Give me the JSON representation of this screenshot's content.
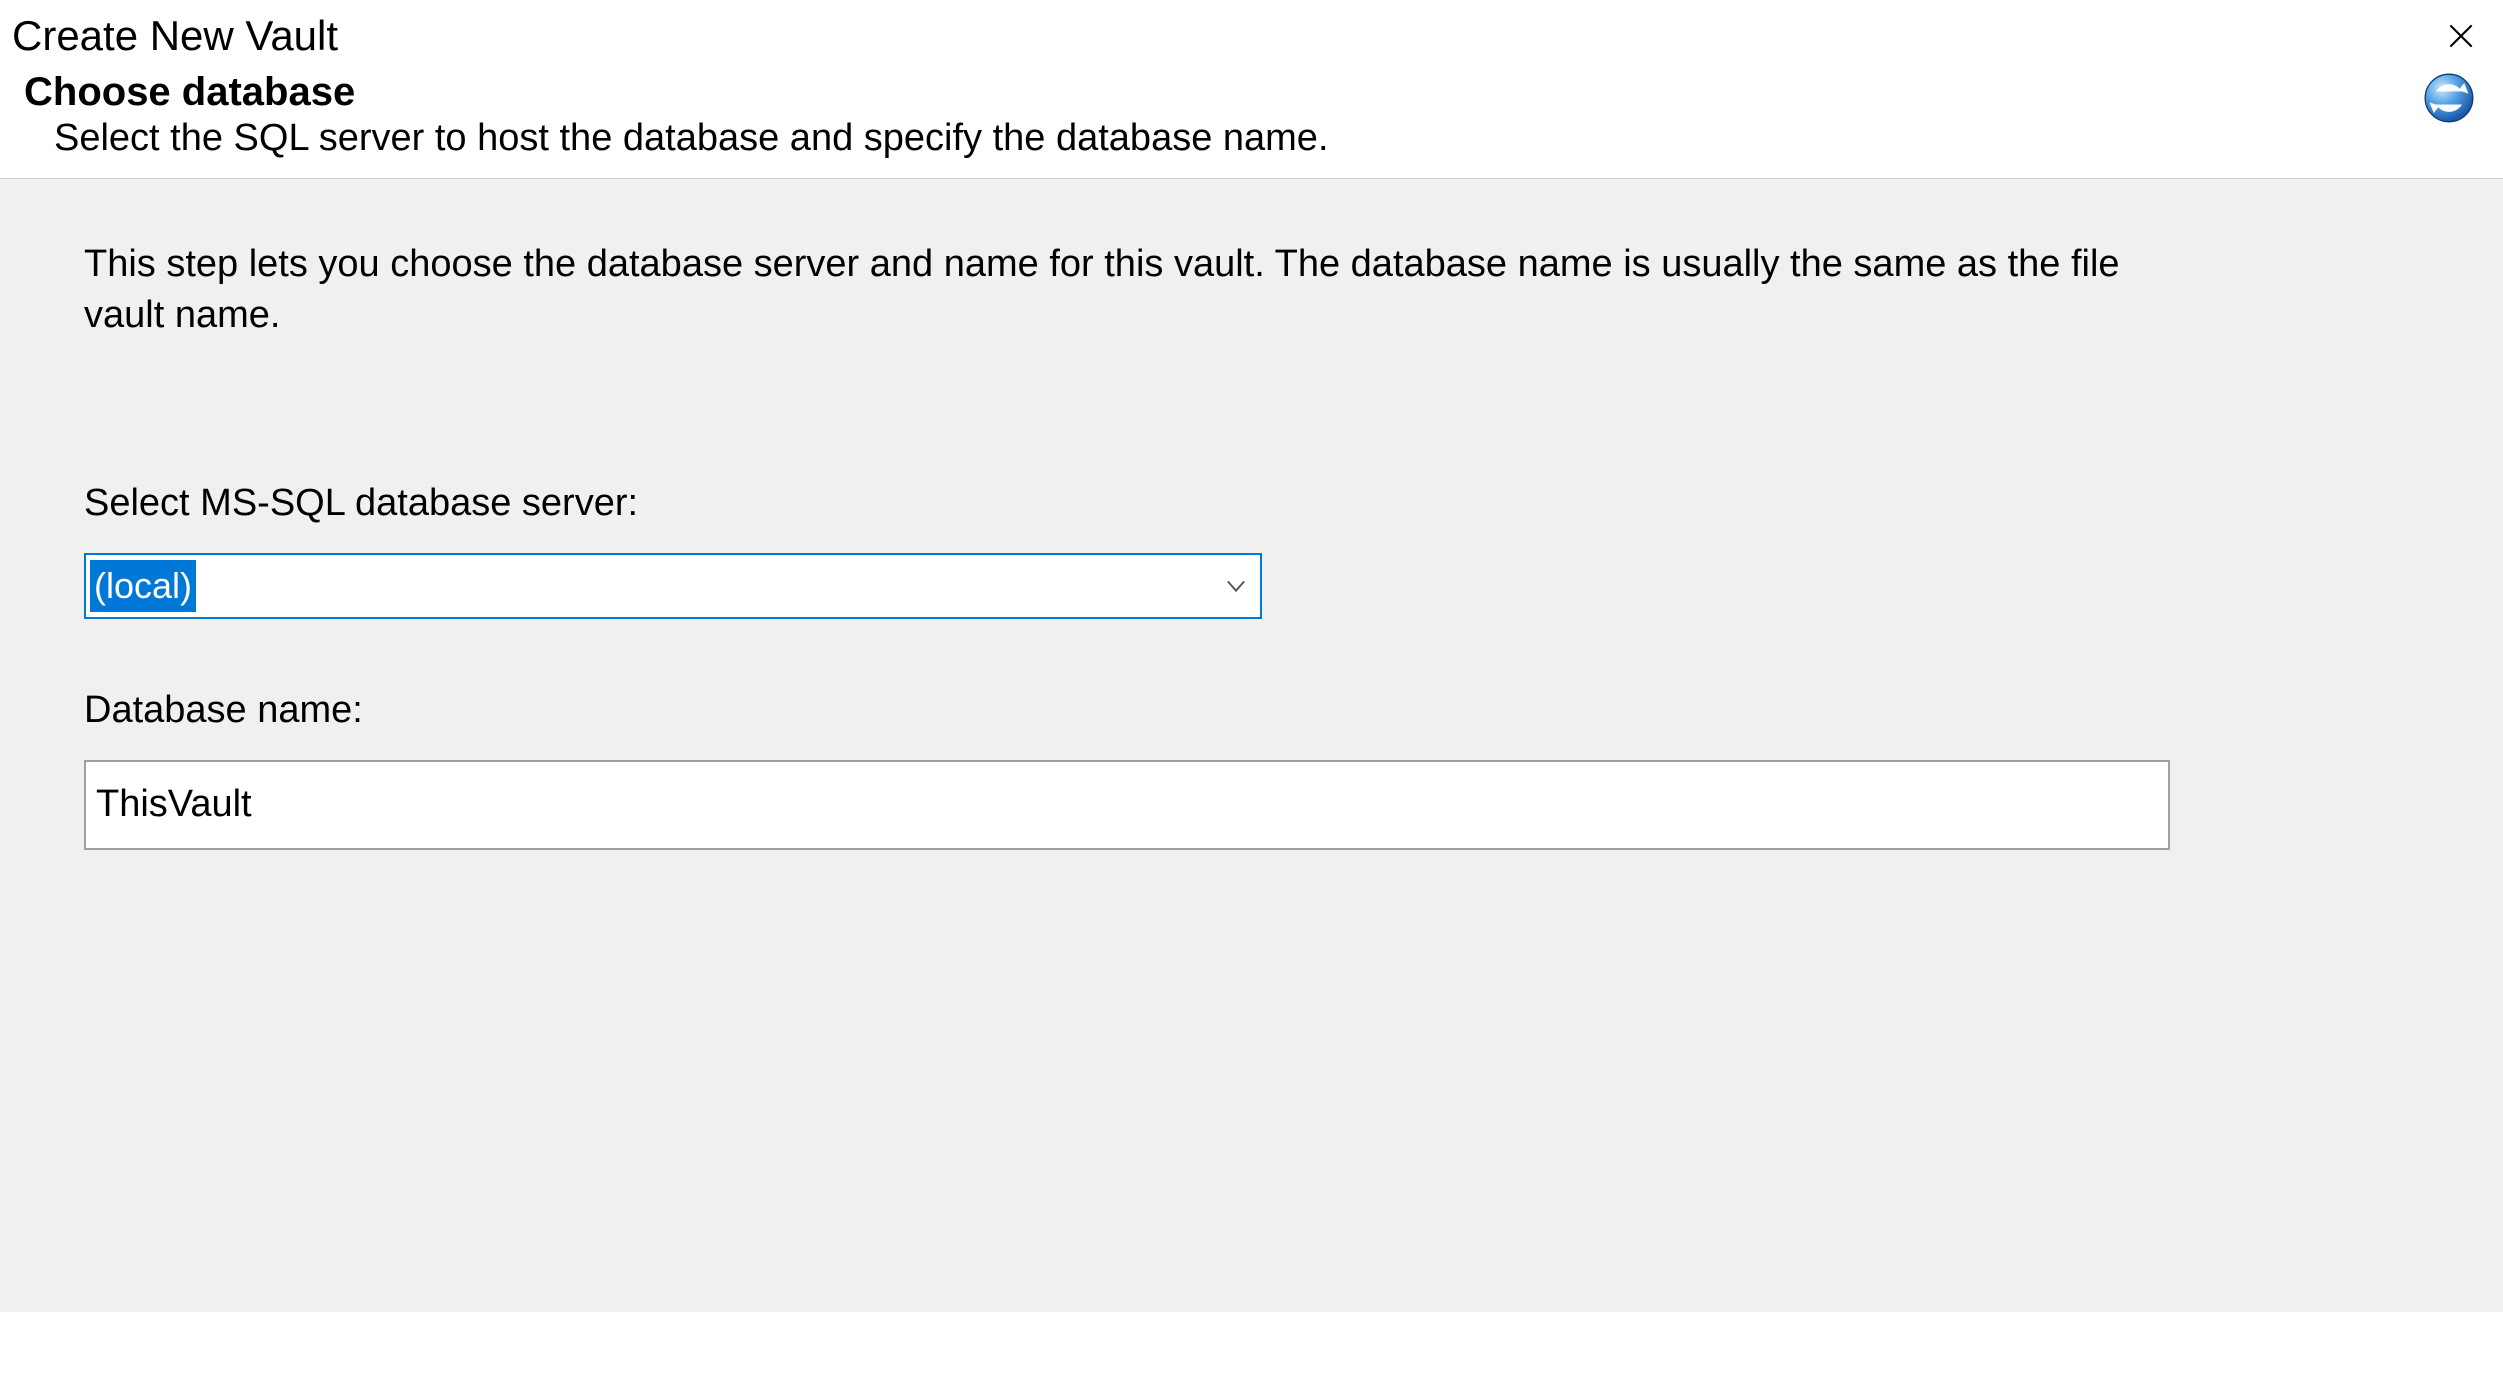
{
  "window": {
    "title": "Create New Vault"
  },
  "header": {
    "step_title": "Choose database",
    "step_subtitle": "Select the SQL server to host the database and specify the database name."
  },
  "content": {
    "description": "This step lets you choose the database server and name for this vault. The database name is usually the same as the file vault name.",
    "server_label": "Select MS-SQL database server:",
    "server_value": "(local)",
    "dbname_label": "Database name:",
    "dbname_value": "ThisVault"
  }
}
